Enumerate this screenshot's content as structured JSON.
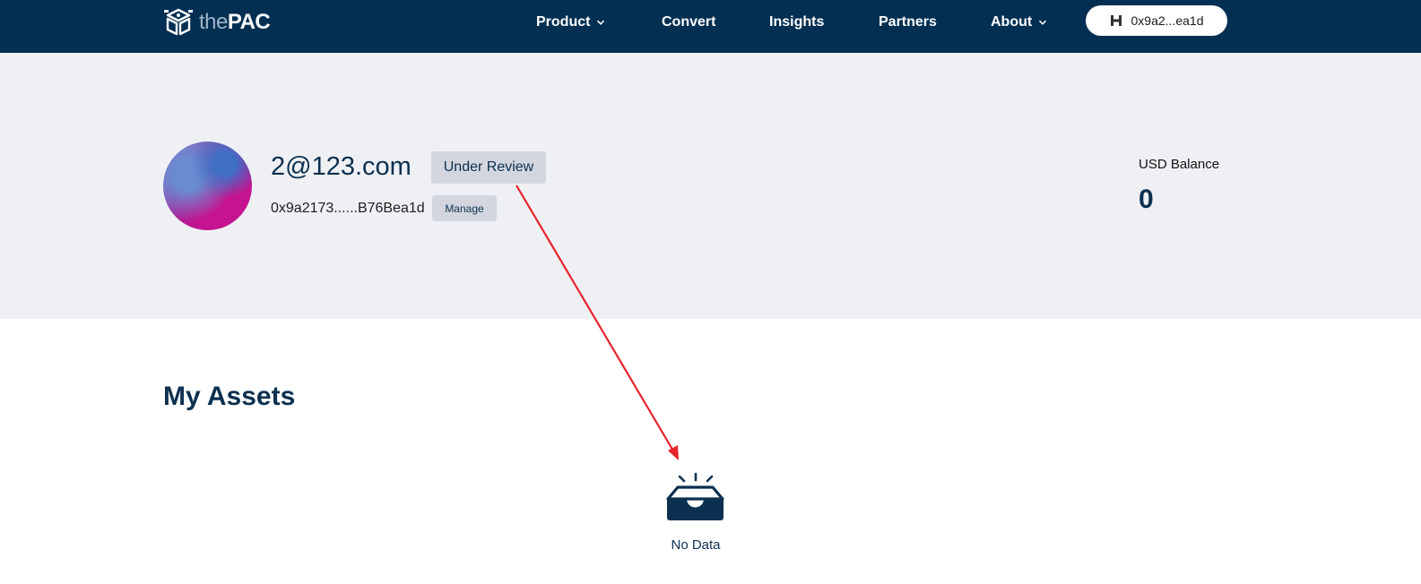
{
  "brand": {
    "prefix": "the",
    "name": "PAC"
  },
  "nav": {
    "product": "Product",
    "convert": "Convert",
    "insights": "Insights",
    "partners": "Partners",
    "about": "About"
  },
  "wallet": {
    "address_short": "0x9a2...ea1d"
  },
  "profile": {
    "email": "2@123.com",
    "status": "Under Review",
    "address": "0x9a2173......B76Bea1d",
    "manage_label": "Manage"
  },
  "balance": {
    "label": "USD Balance",
    "value": "0"
  },
  "assets": {
    "title": "My Assets",
    "empty_text": "No Data"
  },
  "colors": {
    "header_bg": "#022f52",
    "band_bg": "#eff0f4",
    "primary_text": "#0b3050",
    "badge_bg": "#d3d6de",
    "annotation_arrow": "#e8232a"
  },
  "icons": [
    "cube-logo-icon",
    "chevron-down-icon",
    "wallet-logo-icon",
    "empty-inbox-icon"
  ]
}
